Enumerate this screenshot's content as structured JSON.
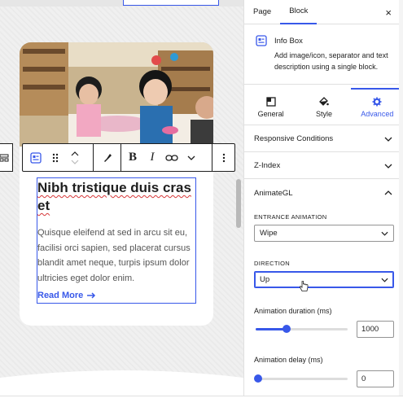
{
  "editor": {
    "block_title_line1": "Nibh tristique duis cras",
    "block_title_line2": "et",
    "block_description": "Quisque eleifend at sed in arcu sit eu, facilisi orci sapien, sed placerat cursus blandit amet neque, turpis ipsum dolor ultricies eget dolor enim.",
    "read_more": "Read More"
  },
  "toolbar": {
    "icons": [
      "block-type-icon",
      "drag-handle-icon",
      "move-up-icon",
      "move-down-icon",
      "highlighter-icon",
      "bold-icon",
      "italic-icon",
      "link-icon",
      "chevron-down-icon",
      "more-options-icon"
    ],
    "bold_label": "B",
    "italic_label": "I"
  },
  "sidebar": {
    "tabs": [
      "Page",
      "Block"
    ],
    "active_tab": "Block",
    "close_label": "×",
    "block_name": "Info Box",
    "block_description": "Add image/icon, separator and text description using a single block.",
    "setting_tabs": [
      {
        "label": "General",
        "icon": "general-icon"
      },
      {
        "label": "Style",
        "icon": "style-icon"
      },
      {
        "label": "Advanced",
        "icon": "gear-icon"
      }
    ],
    "active_setting_tab": "Advanced",
    "sections": {
      "responsive": "Responsive Conditions",
      "zindex": "Z-Index",
      "animate": "AnimateGL"
    },
    "entrance_label": "ENTRANCE ANIMATION",
    "entrance_value": "Wipe",
    "direction_label": "DIRECTION",
    "direction_value": "Up",
    "duration_label": "Animation duration (ms)",
    "duration_value": "1000",
    "duration_fraction": 0.34,
    "delay_label": "Animation delay (ms)",
    "delay_value": "0",
    "delay_fraction": 0.0
  },
  "colors": {
    "accent": "#3858e9",
    "text": "#1e1e1e",
    "spellcheck": "#d63638"
  }
}
